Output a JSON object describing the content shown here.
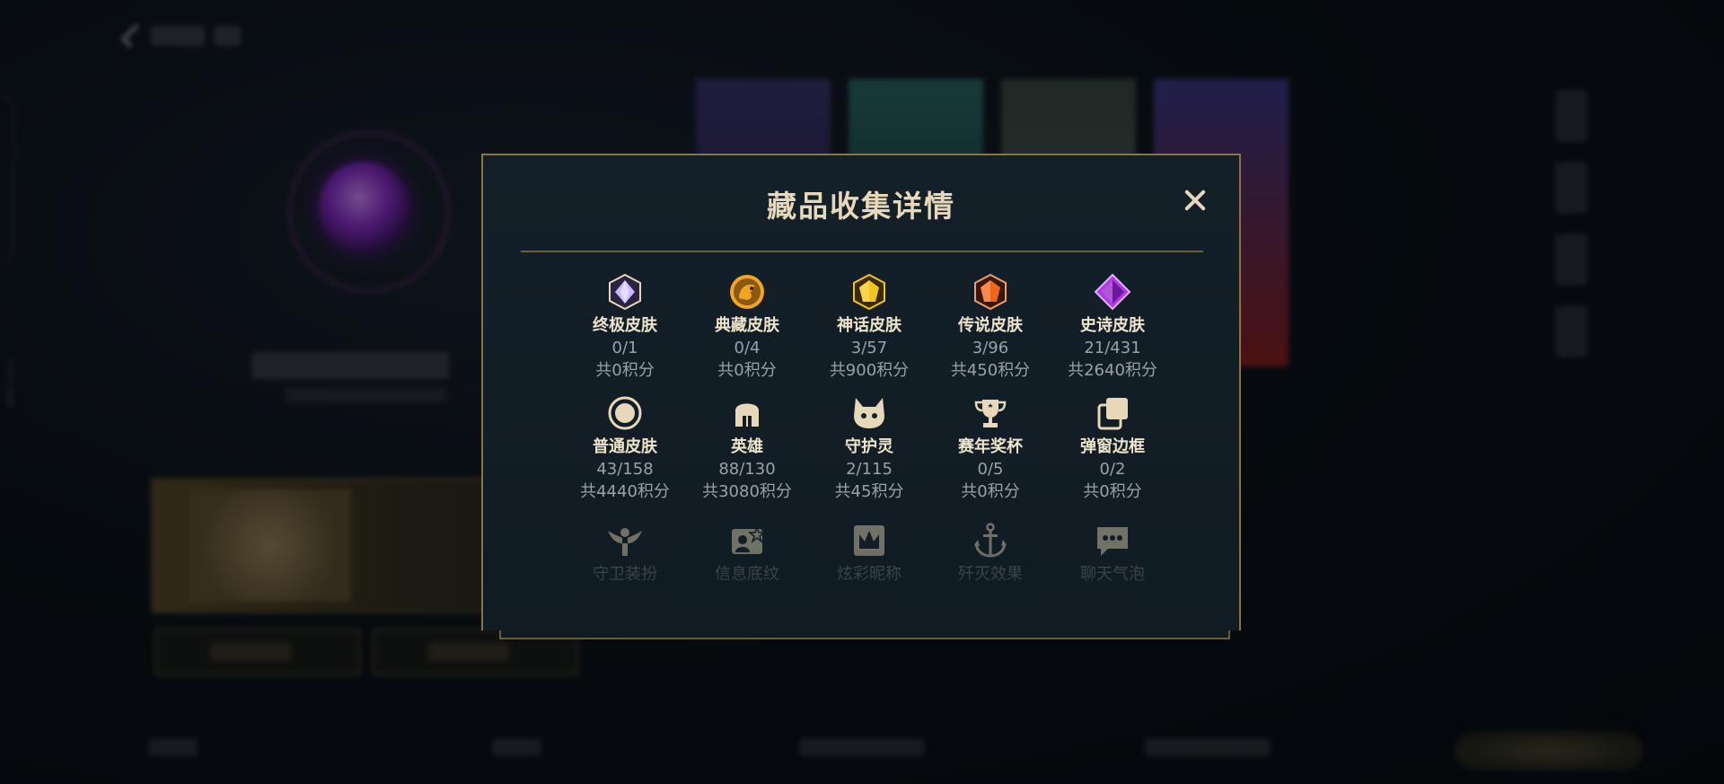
{
  "modal": {
    "title": "藏品收集详情",
    "close_icon": "close-icon"
  },
  "collection": [
    {
      "key": "ultimate-skin",
      "label": "终极皮肤",
      "count": "0/1",
      "points": "共0积分",
      "icon": "ultimate-gem-icon",
      "color": "#c9b7ff"
    },
    {
      "key": "treasure-skin",
      "label": "典藏皮肤",
      "count": "0/4",
      "points": "共0积分",
      "icon": "dragon-emblem-icon",
      "color": "#f0a61e"
    },
    {
      "key": "myth-skin",
      "label": "神话皮肤",
      "count": "3/57",
      "points": "共900积分",
      "icon": "yellow-gem-icon",
      "color": "#f2c41c"
    },
    {
      "key": "legend-skin",
      "label": "传说皮肤",
      "count": "3/96",
      "points": "共450积分",
      "icon": "orange-gem-icon",
      "color": "#f0651c"
    },
    {
      "key": "epic-skin",
      "label": "史诗皮肤",
      "count": "21/431",
      "points": "共2640积分",
      "icon": "purple-gem-icon",
      "color": "#b536e8"
    },
    {
      "key": "normal-skin",
      "label": "普通皮肤",
      "count": "43/158",
      "points": "共4440积分",
      "icon": "circle-icon",
      "color": "#e6d8b8"
    },
    {
      "key": "hero",
      "label": "英雄",
      "count": "88/130",
      "points": "共3080积分",
      "icon": "helmet-icon",
      "color": "#e6d8b8"
    },
    {
      "key": "guardian-spirit",
      "label": "守护灵",
      "count": "2/115",
      "points": "共45积分",
      "icon": "pet-face-icon",
      "color": "#e6d8b8"
    },
    {
      "key": "season-trophy",
      "label": "赛年奖杯",
      "count": "0/5",
      "points": "共0积分",
      "icon": "trophy-icon",
      "color": "#e6d8b8"
    },
    {
      "key": "popup-frame",
      "label": "弹窗边框",
      "count": "0/2",
      "points": "共0积分",
      "icon": "layered-frames-icon",
      "color": "#e6d8b8"
    },
    {
      "key": "guard-outfit",
      "label": "守卫装扮",
      "icon": "winged-guard-icon",
      "color": "#e6d8b8"
    },
    {
      "key": "info-background",
      "label": "信息底纹",
      "icon": "profile-card-icon",
      "color": "#e6d8b8"
    },
    {
      "key": "colorful-nickname",
      "label": "炫彩昵称",
      "icon": "crown-card-icon",
      "color": "#e6d8b8"
    },
    {
      "key": "kill-effect",
      "label": "歼灭效果",
      "icon": "anchor-icon",
      "color": "#e6d8b8"
    },
    {
      "key": "chat-bubble",
      "label": "聊天气泡",
      "icon": "chat-bubble-icon",
      "color": "#e6d8b8"
    }
  ],
  "background": {
    "side_tag": "3327404"
  },
  "colors": {
    "modal_border": "#8a7444",
    "title": "#e6d8b8",
    "label": "#eee4cc",
    "muted": "#9aa1a8"
  }
}
